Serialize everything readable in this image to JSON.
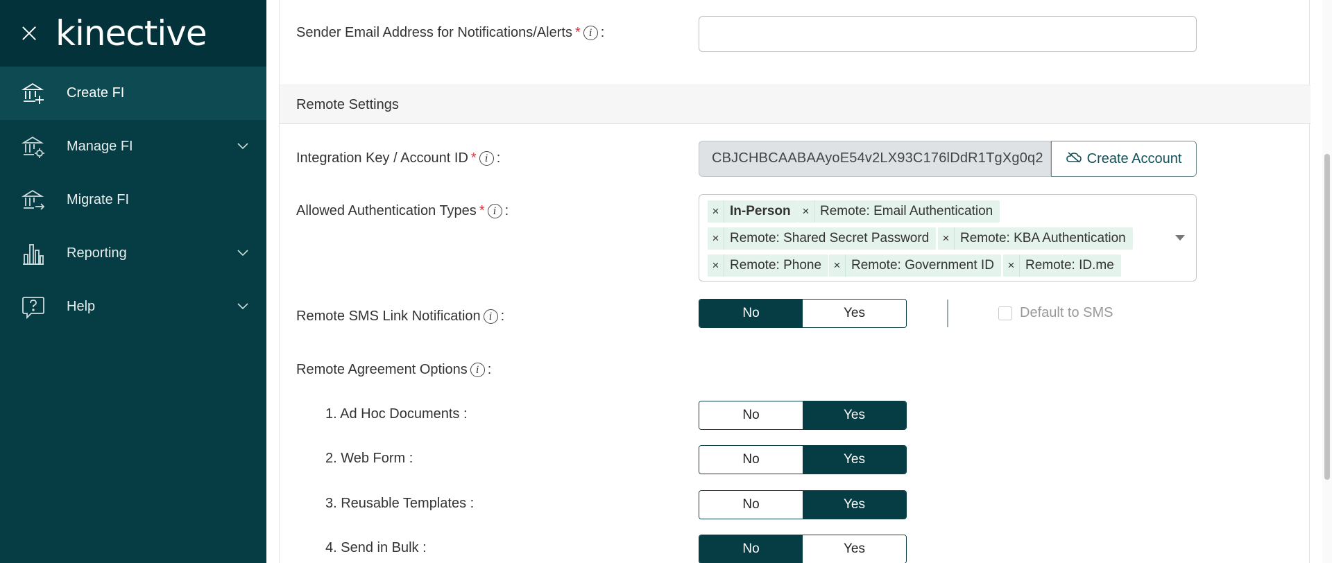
{
  "sidebar": {
    "logo": "kinective",
    "items": [
      {
        "label": "Create FI",
        "icon": "bank-add-icon"
      },
      {
        "label": "Manage FI",
        "icon": "bank-gear-icon"
      },
      {
        "label": "Migrate FI",
        "icon": "bank-arrow-icon"
      },
      {
        "label": "Reporting",
        "icon": "bar-chart-icon"
      },
      {
        "label": "Help",
        "icon": "help-bubble-icon"
      }
    ]
  },
  "form": {
    "sender_email": {
      "label": "Sender Email Address for Notifications/Alerts",
      "value": ""
    },
    "remote_section_title": "Remote Settings",
    "integration_key": {
      "label": "Integration Key / Account ID",
      "value": "CBJCHBCAABAAyoE54v2LX93C176lDdR1TgXg0q2",
      "button": "Create Account"
    },
    "auth_types": {
      "label": "Allowed Authentication Types",
      "tags": [
        "In-Person",
        "Remote: Email Authentication",
        "Remote: Shared Secret Password",
        "Remote: KBA Authentication",
        "Remote: Phone",
        "Remote: Government ID",
        "Remote: ID.me"
      ]
    },
    "sms_link": {
      "label": "Remote SMS Link Notification",
      "selected": "No",
      "checkbox_label": "Default to SMS"
    },
    "agreement_options": {
      "label": "Remote Agreement Options"
    },
    "options": [
      {
        "label": "1. Ad Hoc Documents :",
        "selected": "Yes"
      },
      {
        "label": "2. Web Form :",
        "selected": "Yes"
      },
      {
        "label": "3. Reusable Templates :",
        "selected": "Yes"
      },
      {
        "label": "4. Send in Bulk :",
        "selected": "No"
      }
    ],
    "no_label": "No",
    "yes_label": "Yes",
    "colon": ":",
    "required_mark": "*",
    "info_glyph": "i"
  },
  "colors": {
    "sidebar": "#063c44",
    "accent": "#0b3d45",
    "required": "#d9333a",
    "tag_bg": "#e4f3ec"
  }
}
